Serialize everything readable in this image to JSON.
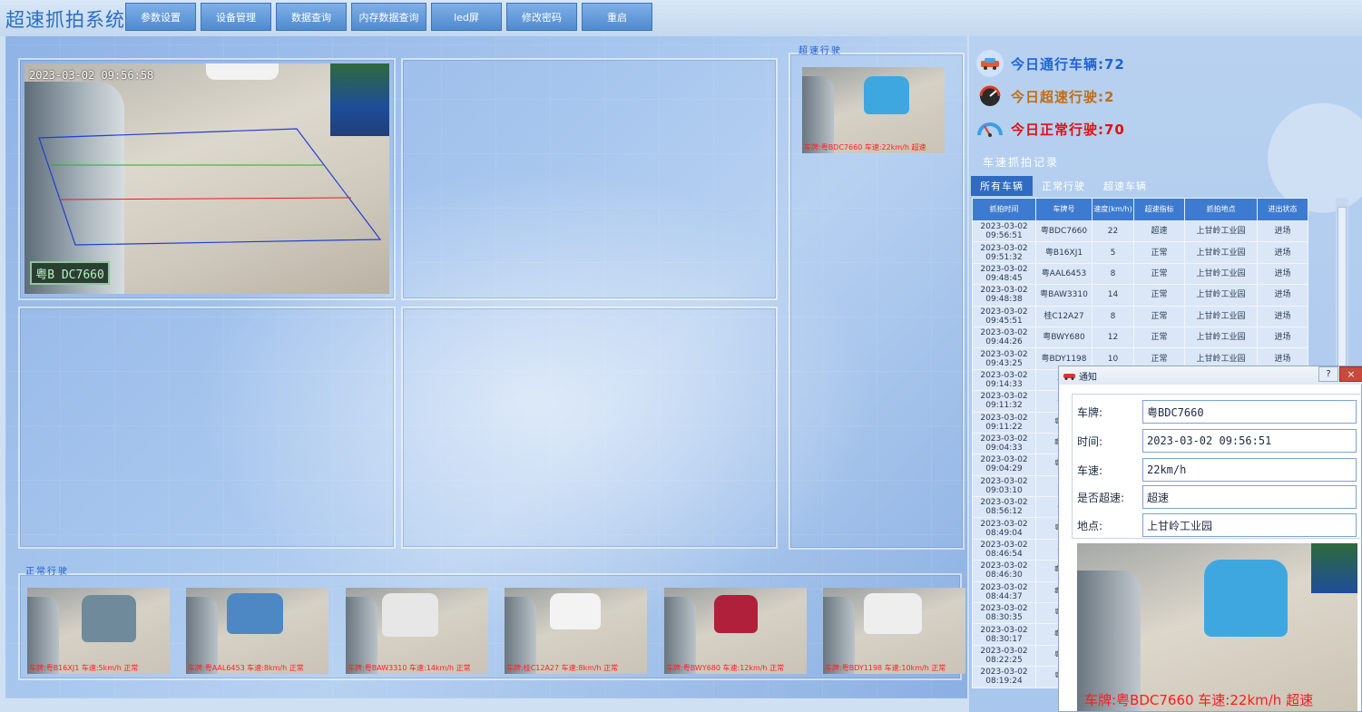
{
  "app_title": "超速抓拍系统",
  "menu": [
    {
      "label": "参数设置"
    },
    {
      "label": "设备管理"
    },
    {
      "label": "数据查询"
    },
    {
      "label": "内存数据查询"
    },
    {
      "label": "led屏"
    },
    {
      "label": "修改密码"
    },
    {
      "label": "重启"
    }
  ],
  "main_camera": {
    "timestamp": "2023-03-02  09:56:58",
    "plate": "粤B DC7660"
  },
  "speeding_section": {
    "tag": "超速行驶",
    "caption": "车牌:粤BDC7660  车速:22km/h  超速"
  },
  "normal_section": {
    "tag": "正常行驶",
    "snapshots": [
      {
        "caption": "车牌:粤B16XJ1  车速:5km/h  正常",
        "car_color": "#6f8a9a"
      },
      {
        "caption": "车牌:粤AAL6453  车速:8km/h  正常",
        "car_color": "#4e88c4"
      },
      {
        "caption": "车牌:粤BAW3310  车速:14km/h  正常",
        "car_color": "#e7e7e7"
      },
      {
        "caption": "车牌:桂C12A27  车速:8km/h  正常",
        "car_color": "#f3f3f3"
      },
      {
        "caption": "车牌:粤BWY680  车速:12km/h  正常",
        "car_color": "#b0203a"
      },
      {
        "caption": "车牌:粤BDY1198  车速:10km/h  正常",
        "car_color": "#eeeeee"
      }
    ]
  },
  "stats": {
    "today_total": "今日通行车辆:72",
    "today_speeding": "今日超速行驶:2",
    "today_normal": "今日正常行驶:70",
    "colors": {
      "total": "#1e63d8",
      "speeding": "#c06d12",
      "normal": "#e01010"
    }
  },
  "records": {
    "title": "车速抓拍记录",
    "tabs": [
      {
        "label": "所有车辆"
      },
      {
        "label": "正常行驶"
      },
      {
        "label": "超速车辆"
      }
    ],
    "columns": [
      {
        "label": "抓拍时间"
      },
      {
        "label": "车牌号"
      },
      {
        "label": "速度(km/h)"
      },
      {
        "label": "超速指标"
      },
      {
        "label": "抓拍地点"
      },
      {
        "label": "进出状态"
      }
    ],
    "rows": [
      {
        "date": "2023-03-02",
        "time": "09:56:51",
        "plate": "粤BDC7660",
        "speed": "22",
        "flag": "超速",
        "place": "上甘岭工业园",
        "status": "进场"
      },
      {
        "date": "2023-03-02",
        "time": "09:51:32",
        "plate": "粤B16XJ1",
        "speed": "5",
        "flag": "正常",
        "place": "上甘岭工业园",
        "status": "进场"
      },
      {
        "date": "2023-03-02",
        "time": "09:48:45",
        "plate": "粤AAL6453",
        "speed": "8",
        "flag": "正常",
        "place": "上甘岭工业园",
        "status": "进场"
      },
      {
        "date": "2023-03-02",
        "time": "09:48:38",
        "plate": "粤BAW3310",
        "speed": "14",
        "flag": "正常",
        "place": "上甘岭工业园",
        "status": "进场"
      },
      {
        "date": "2023-03-02",
        "time": "09:45:51",
        "plate": "桂C12A27",
        "speed": "8",
        "flag": "正常",
        "place": "上甘岭工业园",
        "status": "进场"
      },
      {
        "date": "2023-03-02",
        "time": "09:44:26",
        "plate": "粤BWY680",
        "speed": "12",
        "flag": "正常",
        "place": "上甘岭工业园",
        "status": "进场"
      },
      {
        "date": "2023-03-02",
        "time": "09:43:25",
        "plate": "粤BDY1198",
        "speed": "10",
        "flag": "正常",
        "place": "上甘岭工业园",
        "status": "进场"
      },
      {
        "date": "2023-03-02",
        "time": "09:14:33",
        "plate": "粤B",
        "speed": "",
        "flag": "",
        "place": "",
        "status": ""
      },
      {
        "date": "2023-03-02",
        "time": "09:11:32",
        "plate": "粤B",
        "speed": "",
        "flag": "",
        "place": "",
        "status": ""
      },
      {
        "date": "2023-03-02",
        "time": "09:11:22",
        "plate": "粤BA",
        "speed": "",
        "flag": "",
        "place": "",
        "status": ""
      },
      {
        "date": "2023-03-02",
        "time": "09:04:33",
        "plate": "粤BD",
        "speed": "",
        "flag": "",
        "place": "",
        "status": ""
      },
      {
        "date": "2023-03-02",
        "time": "09:04:29",
        "plate": "粤BA",
        "speed": "",
        "flag": "",
        "place": "",
        "status": ""
      },
      {
        "date": "2023-03-02",
        "time": "09:03:10",
        "plate": "粤B",
        "speed": "",
        "flag": "",
        "place": "",
        "status": ""
      },
      {
        "date": "2023-03-02",
        "time": "08:56:12",
        "plate": "粤B",
        "speed": "",
        "flag": "",
        "place": "",
        "status": ""
      },
      {
        "date": "2023-03-02",
        "time": "08:49:04",
        "plate": "粤BE",
        "speed": "",
        "flag": "",
        "place": "",
        "status": ""
      },
      {
        "date": "2023-03-02",
        "time": "08:46:54",
        "plate": "粤B",
        "speed": "",
        "flag": "",
        "place": "",
        "status": ""
      },
      {
        "date": "2023-03-02",
        "time": "08:46:30",
        "plate": "粤BD",
        "speed": "",
        "flag": "",
        "place": "",
        "status": ""
      },
      {
        "date": "2023-03-02",
        "time": "08:44:37",
        "plate": "粤BD",
        "speed": "",
        "flag": "",
        "place": "",
        "status": ""
      },
      {
        "date": "2023-03-02",
        "time": "08:30:35",
        "plate": "粤BE",
        "speed": "",
        "flag": "",
        "place": "",
        "status": ""
      },
      {
        "date": "2023-03-02",
        "time": "08:30:17",
        "plate": "粤BD",
        "speed": "",
        "flag": "",
        "place": "",
        "status": ""
      },
      {
        "date": "2023-03-02",
        "time": "08:22:25",
        "plate": "粤BA",
        "speed": "",
        "flag": "",
        "place": "",
        "status": ""
      },
      {
        "date": "2023-03-02",
        "time": "08:19:24",
        "plate": "粤BE",
        "speed": "",
        "flag": "",
        "place": "",
        "status": ""
      }
    ]
  },
  "dialog": {
    "title": "通知",
    "help": "?",
    "close": "×",
    "fields": [
      {
        "label": "车牌:",
        "value": "粤BDC7660"
      },
      {
        "label": "时间:",
        "value": "2023-03-02 09:56:51"
      },
      {
        "label": "车速:",
        "value": "22km/h"
      },
      {
        "label": "是否超速:",
        "value": "超速"
      },
      {
        "label": "地点:",
        "value": "上甘岭工业园"
      }
    ],
    "photo_caption": "车牌:粤BDC7660  车速:22km/h  超速"
  }
}
